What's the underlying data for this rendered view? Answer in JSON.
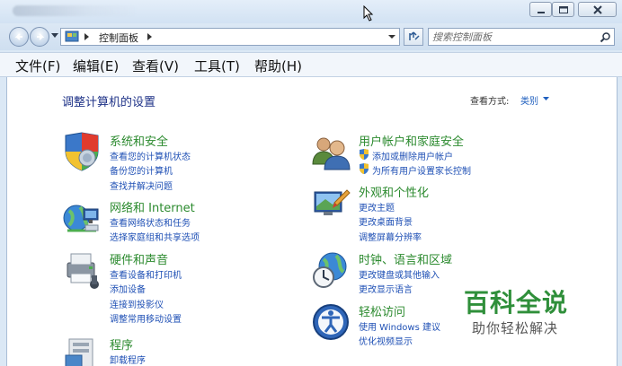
{
  "window": {
    "controls": {
      "minimize_icon": "minimize-icon",
      "maximize_icon": "maximize-icon",
      "close_icon": "close-icon"
    }
  },
  "address_bar": {
    "breadcrumb": "控制面板",
    "search_placeholder": "搜索控制面板"
  },
  "menu": {
    "items": [
      "文件(F)",
      "编辑(E)",
      "查看(V)",
      "工具(T)",
      "帮助(H)"
    ]
  },
  "content": {
    "title": "调整计算机的设置",
    "view_by_label": "查看方式:",
    "view_by_value": "类别",
    "categories": [
      {
        "title": "系统和安全",
        "icon": "system-security-icon",
        "links": [
          "查看您的计算机状态",
          "备份您的计算机",
          "查找并解决问题"
        ]
      },
      {
        "title": "网络和 Internet",
        "icon": "network-internet-icon",
        "links": [
          "查看网络状态和任务",
          "选择家庭组和共享选项"
        ]
      },
      {
        "title": "硬件和声音",
        "icon": "hardware-sound-icon",
        "links": [
          "查看设备和打印机",
          "添加设备",
          "连接到投影仪",
          "调整常用移动设置"
        ]
      },
      {
        "title": "程序",
        "icon": "programs-icon",
        "links": [
          "卸载程序"
        ]
      },
      {
        "title": "用户帐户和家庭安全",
        "icon": "user-accounts-icon",
        "links": [
          "添加或删除用户帐户",
          "为所有用户设置家长控制"
        ]
      },
      {
        "title": "外观和个性化",
        "icon": "appearance-icon",
        "links": [
          "更改主题",
          "更改桌面背景",
          "调整屏幕分辨率"
        ]
      },
      {
        "title": "时钟、语言和区域",
        "icon": "clock-language-region-icon",
        "links": [
          "更改键盘或其他输入",
          "更改显示语言"
        ]
      },
      {
        "title": "轻松访问",
        "icon": "ease-of-access-icon",
        "links": [
          "使用 Windows 建议",
          "优化视频显示"
        ]
      }
    ]
  },
  "watermark": {
    "title": "百科全说",
    "subtitle": "助你轻松解决"
  },
  "colors": {
    "category_title": "#2b8a2e",
    "link": "#1f50b5",
    "page_title": "#1e3287"
  }
}
